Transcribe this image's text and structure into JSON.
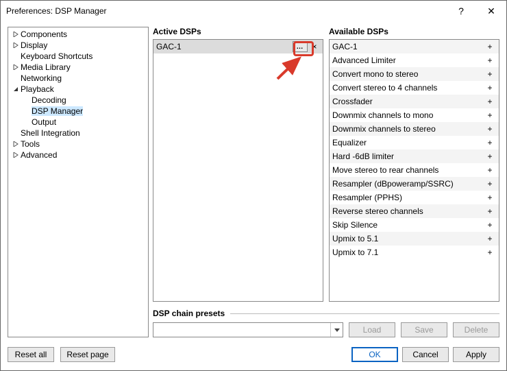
{
  "title": "Preferences: DSP Manager",
  "tree": [
    {
      "label": "Components",
      "depth": 0,
      "twist": "right",
      "selected": false
    },
    {
      "label": "Display",
      "depth": 0,
      "twist": "right",
      "selected": false
    },
    {
      "label": "Keyboard Shortcuts",
      "depth": 0,
      "twist": "",
      "selected": false
    },
    {
      "label": "Media Library",
      "depth": 0,
      "twist": "right",
      "selected": false
    },
    {
      "label": "Networking",
      "depth": 0,
      "twist": "",
      "selected": false
    },
    {
      "label": "Playback",
      "depth": 0,
      "twist": "down",
      "selected": false
    },
    {
      "label": "Decoding",
      "depth": 1,
      "twist": "",
      "selected": false
    },
    {
      "label": "DSP Manager",
      "depth": 1,
      "twist": "",
      "selected": true
    },
    {
      "label": "Output",
      "depth": 1,
      "twist": "",
      "selected": false
    },
    {
      "label": "Shell Integration",
      "depth": 0,
      "twist": "",
      "selected": false
    },
    {
      "label": "Tools",
      "depth": 0,
      "twist": "right",
      "selected": false
    },
    {
      "label": "Advanced",
      "depth": 0,
      "twist": "right",
      "selected": false
    }
  ],
  "headers": {
    "active": "Active DSPs",
    "available": "Available DSPs",
    "presets": "DSP chain presets"
  },
  "active_dsps": [
    {
      "name": "GAC-1",
      "selected": true
    }
  ],
  "available_dsps": [
    "GAC-1",
    "Advanced Limiter",
    "Convert mono to stereo",
    "Convert stereo to 4 channels",
    "Crossfader",
    "Downmix channels to mono",
    "Downmix channels to stereo",
    "Equalizer",
    "Hard -6dB limiter",
    "Move stereo to rear channels",
    "Resampler (dBpoweramp/SSRC)",
    "Resampler (PPHS)",
    "Reverse stereo channels",
    "Skip Silence",
    "Upmix to 5.1",
    "Upmix to 7.1"
  ],
  "icons": {
    "ellipsis": "…",
    "close": "×",
    "plus": "+",
    "help": "?",
    "winclose": "✕"
  },
  "buttons": {
    "load": "Load",
    "save": "Save",
    "delete": "Delete",
    "reset_all": "Reset all",
    "reset_page": "Reset page",
    "ok": "OK",
    "cancel": "Cancel",
    "apply": "Apply"
  }
}
